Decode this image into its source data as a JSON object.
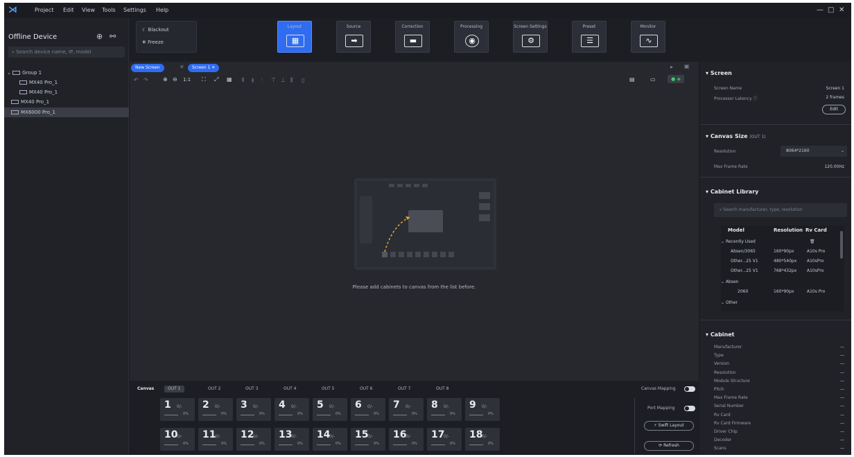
{
  "menubar": {
    "items": [
      "Project",
      "Edit",
      "View",
      "Tools",
      "Settings",
      "Help"
    ],
    "win_controls": [
      "—",
      "□",
      "✕"
    ]
  },
  "left_panel": {
    "title": "Offline Device",
    "search_placeholder": "Search device name, IP, model",
    "tree": [
      {
        "label": "Group 1",
        "level": 0,
        "expanded": true
      },
      {
        "label": "MX40 Pro_1",
        "level": 1
      },
      {
        "label": "MX40 Pro_1",
        "level": 1
      },
      {
        "label": "MX40 Pro_1",
        "level": 0
      },
      {
        "label": "MX6000 Pro_1",
        "level": 0,
        "selected": true
      }
    ]
  },
  "toolbar": {
    "blackout_label": "Blackout",
    "freeze_label": "Freeze",
    "tools": [
      {
        "label": "Layout",
        "icon": "layout-grid-icon",
        "active": true
      },
      {
        "label": "Source",
        "icon": "source-arrow-icon"
      },
      {
        "label": "Correction",
        "icon": "correction-icon"
      },
      {
        "label": "Processing",
        "icon": "processing-color-wheel-icon"
      },
      {
        "label": "Screen Settings",
        "icon": "screen-settings-icon"
      },
      {
        "label": "Preset",
        "icon": "preset-sliders-icon"
      },
      {
        "label": "Monitor",
        "icon": "monitor-pulse-icon"
      }
    ]
  },
  "canvas": {
    "tabs": [
      "New Screen",
      "Screen 1"
    ],
    "zoom_label": "1:1",
    "empty_message": "Please add cabinets to canvas from the list before."
  },
  "outputs": {
    "canvas_label": "Canvas",
    "tabs": [
      "OUT 1",
      "OUT 2",
      "OUT 3",
      "OUT 4",
      "OUT 5",
      "OUT 6",
      "OUT 7",
      "OUT 8"
    ],
    "tiles": [
      {
        "num": "1",
        "frac": "0/-",
        "pct": "0%"
      },
      {
        "num": "2",
        "frac": "0/-",
        "pct": "0%"
      },
      {
        "num": "3",
        "frac": "0/-",
        "pct": "0%"
      },
      {
        "num": "4",
        "frac": "0/-",
        "pct": "0%"
      },
      {
        "num": "5",
        "frac": "0/-",
        "pct": "0%"
      },
      {
        "num": "6",
        "frac": "0/-",
        "pct": "0%"
      },
      {
        "num": "7",
        "frac": "0/-",
        "pct": "0%"
      },
      {
        "num": "8",
        "frac": "0/-",
        "pct": "0%"
      },
      {
        "num": "9",
        "frac": "0/-",
        "pct": "0%"
      },
      {
        "num": "10",
        "frac": "0/-",
        "pct": "0%"
      },
      {
        "num": "11",
        "frac": "0/-",
        "pct": "0%"
      },
      {
        "num": "12",
        "frac": "0/-",
        "pct": "0%"
      },
      {
        "num": "13",
        "frac": "0/-",
        "pct": "0%"
      },
      {
        "num": "14",
        "frac": "0/-",
        "pct": "0%"
      },
      {
        "num": "15",
        "frac": "0/-",
        "pct": "0%"
      },
      {
        "num": "16",
        "frac": "0/-",
        "pct": "0%"
      },
      {
        "num": "17",
        "frac": "0/-",
        "pct": "0%"
      },
      {
        "num": "18",
        "frac": "0/-",
        "pct": "0%"
      }
    ],
    "canvas_mapping_label": "Canvas Mapping",
    "port_mapping_label": "Port Mapping",
    "swift_layout_label": "Swift Layout",
    "refresh_label": "Refresh"
  },
  "right_panel": {
    "screen": {
      "title": "Screen",
      "rows": [
        {
          "k": "Screen Name",
          "v": "Screen 1"
        },
        {
          "k": "Processor Latency",
          "v": "2 frames"
        }
      ],
      "edit_label": "Edit"
    },
    "canvas_size": {
      "title": "Canvas Size",
      "subtitle": "(OUT 1)",
      "resolution_label": "Resolution",
      "resolution_value": "8064*2160",
      "max_frame_rate_label": "Max Frame Rate",
      "max_frame_rate_value": "120.00Hz"
    },
    "cabinet_library": {
      "title": "Cabinet Library",
      "search_placeholder": "Search manufacturer, type, resolution",
      "headers": [
        "Model",
        "Resolution",
        "Rv Card"
      ],
      "rows": [
        {
          "group": "Recently Used"
        },
        {
          "model": "Absen/3065",
          "res": "160*90px",
          "card": "A10s Pro"
        },
        {
          "model": "Other...25 V1",
          "res": "480*540px",
          "card": "A10sPro"
        },
        {
          "model": "Other...25 V1",
          "res": "768*432px",
          "card": "A10sPro"
        },
        {
          "group": "Absen"
        },
        {
          "model": "2060",
          "res": "160*90px",
          "card": "A10s Pro"
        },
        {
          "group": "Other"
        }
      ]
    },
    "cabinet": {
      "title": "Cabinet",
      "rows": [
        {
          "k": "Manufacturer",
          "v": "—"
        },
        {
          "k": "Type",
          "v": "—"
        },
        {
          "k": "Version",
          "v": "—"
        },
        {
          "k": "Resolution",
          "v": "—"
        },
        {
          "k": "Module Structure",
          "v": "—"
        },
        {
          "k": "Pitch",
          "v": "—"
        },
        {
          "k": "Max Frame Rate",
          "v": "—"
        },
        {
          "k": "Serial Number",
          "v": "—"
        },
        {
          "k": "Rv Card",
          "v": "—"
        },
        {
          "k": "Rv Card Firmware",
          "v": "—"
        },
        {
          "k": "Driver Chip",
          "v": "—"
        },
        {
          "k": "Decoder",
          "v": "—"
        },
        {
          "k": "Scans",
          "v": "—"
        }
      ]
    }
  }
}
